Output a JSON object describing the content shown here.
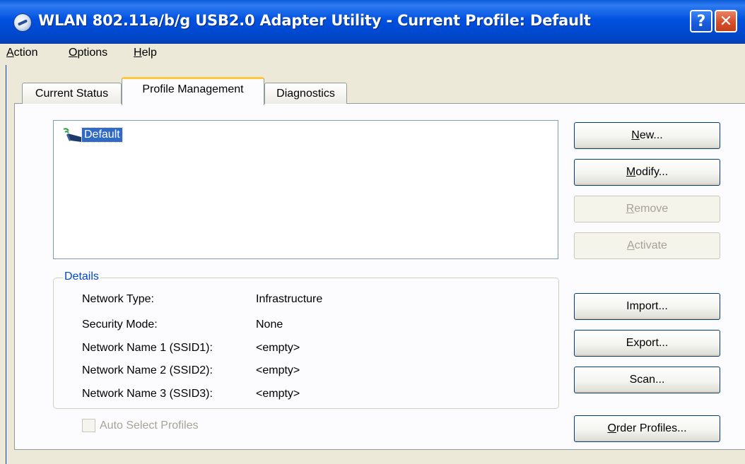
{
  "window": {
    "title": "WLAN 802.11a/b/g USB2.0 Adapter Utility - Current Profile: Default",
    "help_button": "?",
    "close_button": "✕"
  },
  "menu": {
    "items": [
      {
        "accel": "A",
        "rest": "ction"
      },
      {
        "accel": "O",
        "rest": "ptions"
      },
      {
        "accel": "H",
        "rest": "elp"
      }
    ]
  },
  "tabs": [
    {
      "label": "Current Status",
      "selected": false
    },
    {
      "label": "Profile Management",
      "selected": true
    },
    {
      "label": "Diagnostics",
      "selected": false
    }
  ],
  "profiles": [
    {
      "name": "Default",
      "selected": true
    }
  ],
  "details": {
    "legend": "Details",
    "rows": [
      {
        "label": "Network Type:",
        "value": "Infrastructure"
      },
      {
        "label": "Security Mode:",
        "value": "None"
      },
      {
        "label": "Network Name 1 (SSID1):",
        "value": "<empty>"
      },
      {
        "label": "Network Name 2 (SSID2):",
        "value": "<empty>"
      },
      {
        "label": "Network Name 3 (SSID3):",
        "value": "<empty>"
      }
    ]
  },
  "auto_select": {
    "label": "Auto Select Profiles",
    "checked": false,
    "enabled": false
  },
  "buttons": {
    "new": {
      "accel": "N",
      "rest": "ew...",
      "enabled": true
    },
    "modify": {
      "accel": "M",
      "rest": "odify...",
      "enabled": true
    },
    "remove": {
      "accel": "R",
      "rest": "emove",
      "enabled": false
    },
    "activate": {
      "accel": "A",
      "rest": "ctivate",
      "enabled": false
    },
    "import": {
      "label": "Import...",
      "enabled": true
    },
    "export": {
      "label": "Export...",
      "enabled": true
    },
    "scan": {
      "label": "Scan...",
      "enabled": true
    },
    "order": {
      "accel": "O",
      "rest": "rder Profiles...",
      "enabled": true
    }
  },
  "colors": {
    "titlebar": "#0050e0",
    "selection": "#316ac5",
    "details_legend": "#0046d5",
    "active_tab_highlight": "#ffc83c"
  }
}
